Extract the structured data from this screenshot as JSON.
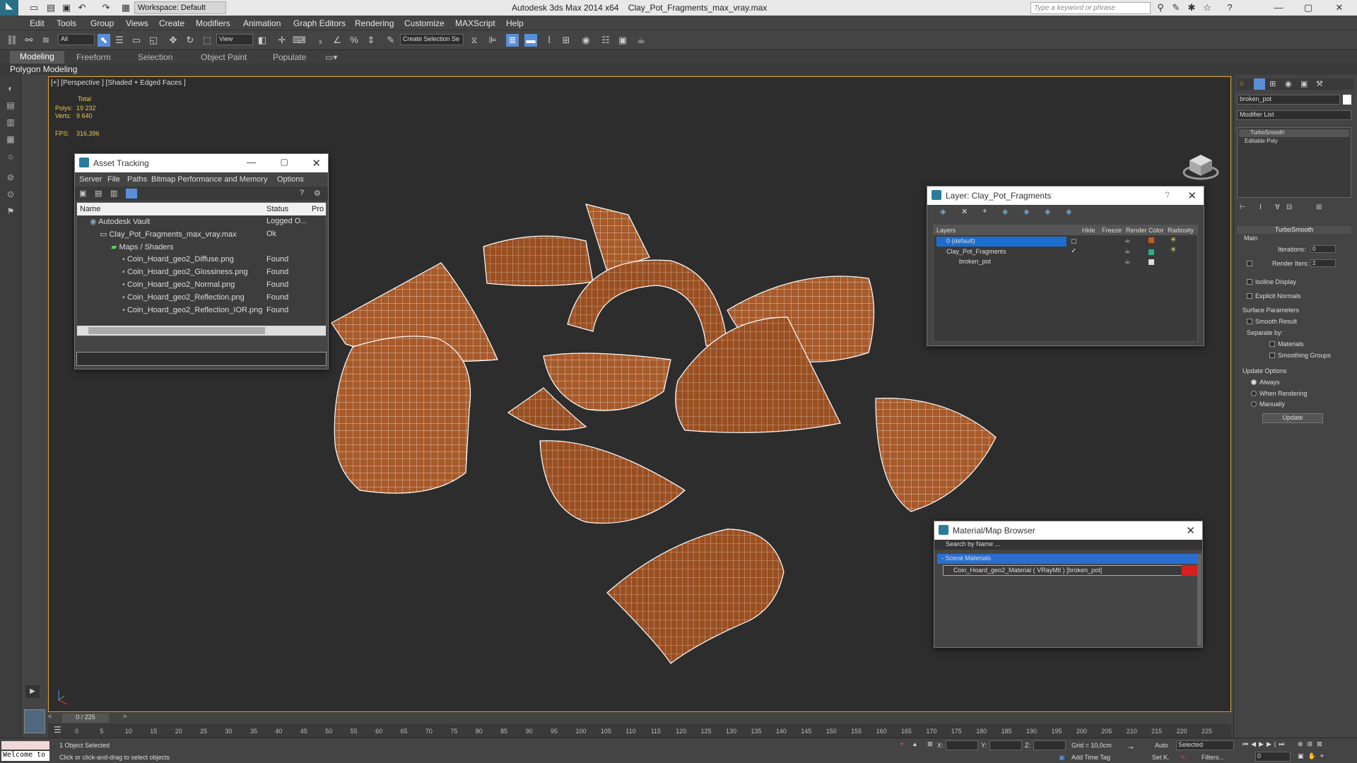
{
  "titlebar": {
    "app": "Autodesk 3ds Max  2014 x64",
    "file": "Clay_Pot_Fragments_max_vray.max",
    "workspace": "Workspace: Default",
    "search_placeholder": "Type a keyword or phrase"
  },
  "menu": [
    "Edit",
    "Tools",
    "Group",
    "Views",
    "Create",
    "Modifiers",
    "Animation",
    "Graph Editors",
    "Rendering",
    "Customize",
    "MAXScript",
    "Help"
  ],
  "toolbar": {
    "filter": "All",
    "refcoord": "View",
    "selset": "Create Selection Se"
  },
  "ribbon": {
    "tabs": [
      "Modeling",
      "Freeform",
      "Selection",
      "Object Paint",
      "Populate"
    ],
    "sub": "Polygon Modeling"
  },
  "viewport": {
    "label": "[+] [Perspective ] [Shaded + Edged Faces ]",
    "stats": {
      "total": "Total",
      "polys_label": "Polys:",
      "polys": "19 232",
      "verts_label": "Verts:",
      "verts": "9 640",
      "fps_label": "FPS:",
      "fps": "316,396"
    }
  },
  "asset_tracking": {
    "title": "Asset Tracking",
    "menu": [
      "Server",
      "File",
      "Paths",
      "Bitmap Performance and Memory",
      "Options"
    ],
    "columns": [
      "Name",
      "Status",
      "Pro"
    ],
    "rows": [
      {
        "name": "Autodesk Vault",
        "status": "Logged O..."
      },
      {
        "name": "Clay_Pot_Fragments_max_vray.max",
        "status": "Ok"
      },
      {
        "name": "Maps / Shaders",
        "status": ""
      },
      {
        "name": "Coin_Hoard_geo2_Diffuse.png",
        "status": "Found"
      },
      {
        "name": "Coin_Hoard_geo2_Glossiness.png",
        "status": "Found"
      },
      {
        "name": "Coin_Hoard_geo2_Normal.png",
        "status": "Found"
      },
      {
        "name": "Coin_Hoard_geo2_Reflection.png",
        "status": "Found"
      },
      {
        "name": "Coin_Hoard_geo2_Reflection_IOR.png",
        "status": "Found"
      }
    ]
  },
  "layer": {
    "title": "Layer: Clay_Pot_Fragments",
    "help": "?",
    "columns": [
      "Layers",
      "Hide",
      "Freeze",
      "Render",
      "Color",
      "Radiosity"
    ],
    "rows": [
      {
        "name": "0 (default)"
      },
      {
        "name": "Clay_Pot_Fragments"
      },
      {
        "name": "broken_pot"
      }
    ],
    "colors": [
      "#c85a1e",
      "#2ab08a",
      "#dddddd"
    ]
  },
  "material_browser": {
    "title": "Material/Map Browser",
    "search": "Search by Name ...",
    "group": "- Scene Materials",
    "item": "Coin_Hoard_geo2_Material ( VRayMtl ) [broken_pot]"
  },
  "command_panel": {
    "object_name": "broken_pot",
    "modifier_list": "Modifier List",
    "stack": [
      "TurboSmooth",
      "Editable Poly"
    ],
    "rollout": "TurboSmooth",
    "main": "Main",
    "iterations_label": "Iterations:",
    "iterations": "0",
    "render_iters_label": "Render Iters:",
    "render_iters": "2",
    "isoline": "Isoline Display",
    "explicit": "Explicit Normals",
    "surface": "Surface Parameters",
    "smooth_result": "Smooth Result",
    "separate": "Separate by:",
    "materials": "Materials",
    "smoothing": "Smoothing Groups",
    "update_options": "Update Options",
    "always": "Always",
    "when_rendering": "When Rendering",
    "manually": "Manually",
    "update_btn": "Update"
  },
  "timeline": {
    "frame": "0 / 225",
    "ticks": [
      "0",
      "5",
      "10",
      "15",
      "20",
      "25",
      "30",
      "35",
      "40",
      "45",
      "50",
      "55",
      "60",
      "65",
      "70",
      "75",
      "80",
      "85",
      "90",
      "95",
      "100",
      "105",
      "110",
      "115",
      "120",
      "125",
      "130",
      "135",
      "140",
      "145",
      "150",
      "155",
      "160",
      "165",
      "170",
      "175",
      "180",
      "185",
      "190",
      "195",
      "200",
      "205",
      "210",
      "215",
      "220",
      "225"
    ]
  },
  "status": {
    "welcome": "Welcome to",
    "selected": "1 Object Selected",
    "hint": "Click or click-and-drag to select objects",
    "x_label": "X:",
    "y_label": "Y:",
    "z_label": "Z:",
    "grid": "Grid = 10,0cm",
    "add_time_tag": "Add Time Tag",
    "auto": "Auto",
    "selected_combo": "Selected",
    "setk": "Set K.",
    "filters": "Filters...",
    "frame": "0"
  }
}
